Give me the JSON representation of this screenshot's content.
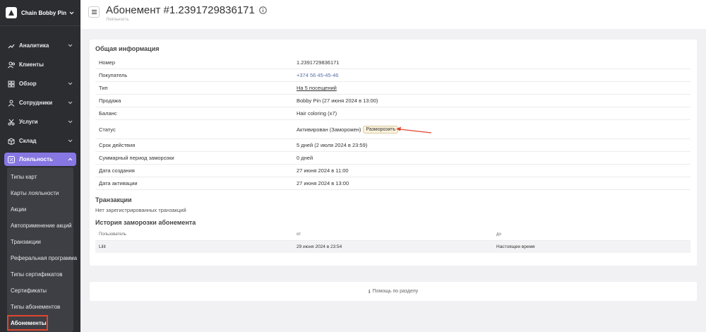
{
  "sidebar": {
    "brand": "Chain Bobby Pin",
    "items": [
      {
        "label": "Аналитика"
      },
      {
        "label": "Клиенты"
      },
      {
        "label": "Обзор"
      },
      {
        "label": "Сотрудники"
      },
      {
        "label": "Услуги"
      },
      {
        "label": "Склад"
      }
    ],
    "active": {
      "label": "Лояльность"
    },
    "sub_items": [
      {
        "label": "Типы карт"
      },
      {
        "label": "Карты лояльности"
      },
      {
        "label": "Акции"
      },
      {
        "label": "Автоприменение акций"
      },
      {
        "label": "Транзакции"
      },
      {
        "label": "Реферальная программа"
      },
      {
        "label": "Типы сертификатов"
      },
      {
        "label": "Сертификаты"
      },
      {
        "label": "Типы абонементов"
      },
      {
        "label": "Абонементы"
      }
    ]
  },
  "header": {
    "title": "Абонемент #1.2391729836171",
    "breadcrumb": "Лояльность"
  },
  "general": {
    "heading": "Общая информация",
    "rows": [
      {
        "key": "Номер",
        "value": "1.2391729836171"
      },
      {
        "key": "Покупатель",
        "value": "+374 56 45-45-46"
      },
      {
        "key": "Тип",
        "value": "На 5 посещений"
      },
      {
        "key": "Продажа",
        "value": "Bobby Pin (27 июня 2024 в 13:00)"
      },
      {
        "key": "Баланс",
        "value": "Hair coloring (x7)"
      },
      {
        "key": "Статус",
        "value": "Активирован (Заморожен)"
      },
      {
        "key": "Срок действия",
        "value": "5 дней (2 июля 2024 в 23:59)"
      },
      {
        "key": "Суммарный период заморозки",
        "value": "0 дней"
      },
      {
        "key": "Дата создания",
        "value": "27 июня 2024 в 11:00"
      },
      {
        "key": "Дата активации",
        "value": "27 июня 2024 в 13:00"
      }
    ],
    "unfreeze_label": "Разморозить"
  },
  "transactions": {
    "heading": "Транзакции",
    "empty": "Нет зарегистрированных транзакций"
  },
  "freeze_history": {
    "heading": "История заморозки абонемента",
    "columns": [
      "Пользователь",
      "от",
      "до"
    ],
    "rows": [
      {
        "user": "Lilit",
        "from": "29 июня 2024 в 23:54",
        "to": "Настоящее время"
      }
    ]
  },
  "help": {
    "label": "Помощь по разделу"
  },
  "colors": {
    "accent": "#8777e3",
    "sidebar": "#2b2d31",
    "highlight": "#e0452f",
    "link": "#5b6fa8"
  }
}
